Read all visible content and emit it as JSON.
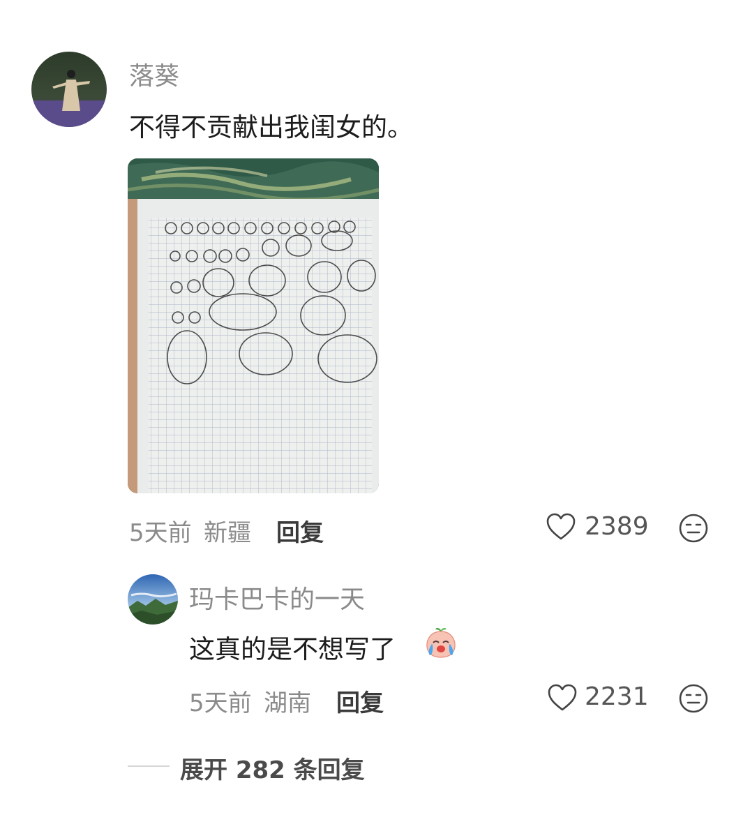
{
  "comment": {
    "username": "落葵",
    "text": "不得不贡献出我闺女的。",
    "time": "5天前",
    "location": "新疆",
    "reply_label": "回复",
    "likes": "2389",
    "image_alt": "notebook page with handwritten letter a practice"
  },
  "reply": {
    "username": "玛卡巴卡的一天",
    "text": "这真的是不想写了",
    "emoji": "crying-peach-emoji",
    "time": "5天前",
    "location": "湖南",
    "reply_label": "回复",
    "likes": "2231"
  },
  "expand": {
    "label": "展开 282 条回复"
  },
  "icons": {
    "like": "heart-outline-icon",
    "dislike": "neutral-face-icon"
  },
  "colors": {
    "username": "#8a8a8a",
    "text": "#1c1c1c",
    "accent_reply": "#3a3a3a"
  }
}
